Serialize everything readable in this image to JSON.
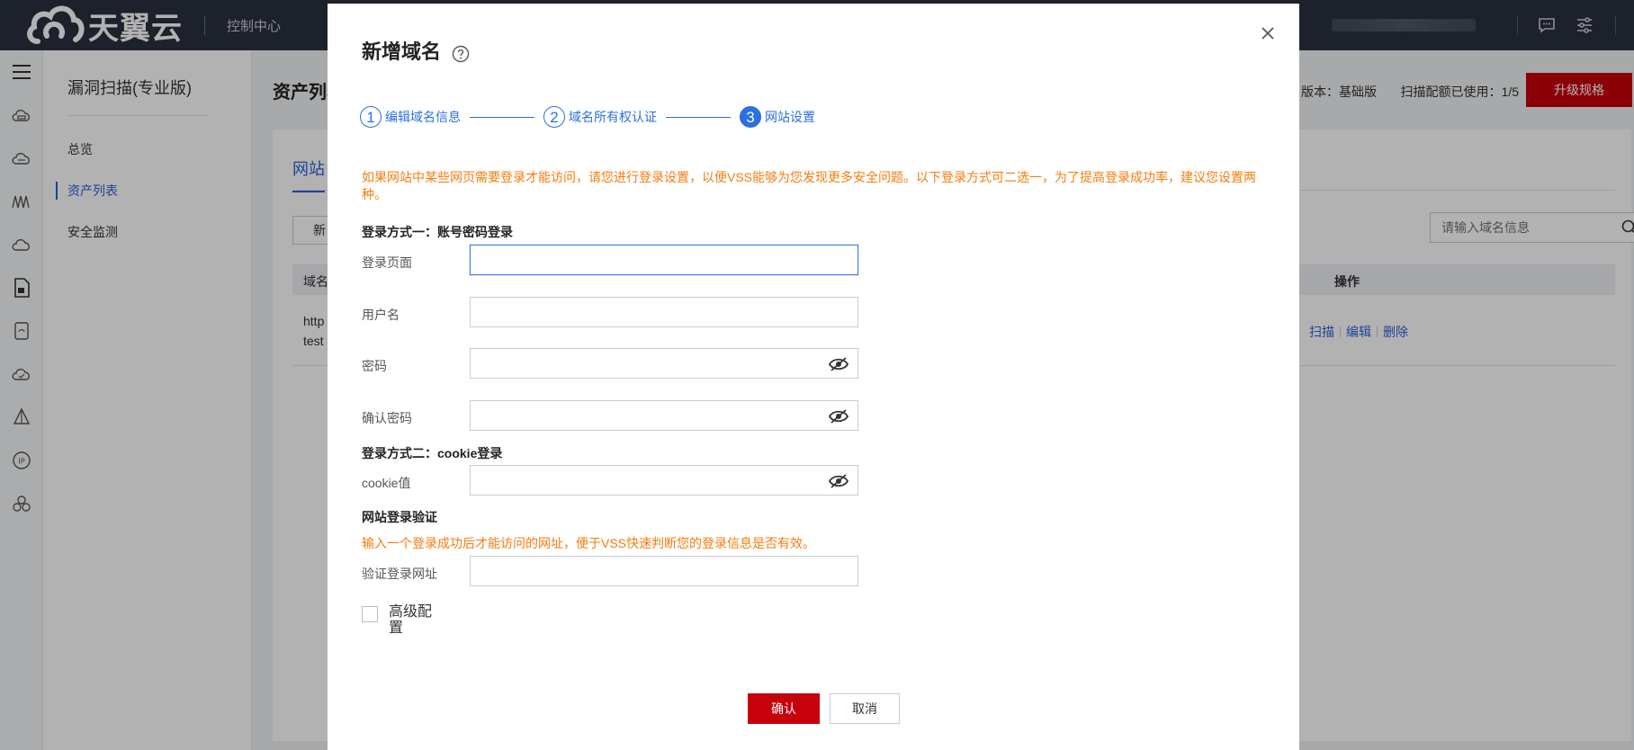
{
  "topbar": {
    "brand": "天翼云",
    "console_link": "控制中心",
    "icons": [
      "message-icon",
      "settings-sliders-icon"
    ]
  },
  "rail": {
    "icons": [
      "menu-icon",
      "cloud-host-icon",
      "cloud-storage-icon",
      "network-icon",
      "cloud-icon",
      "document-icon",
      "device-icon",
      "cloud-check-icon",
      "sail-icon",
      "ip-icon",
      "cluster-icon"
    ]
  },
  "sidebar": {
    "title": "漏洞扫描(专业版)",
    "items": [
      {
        "label": "总览"
      },
      {
        "label": "资产列表"
      },
      {
        "label": "安全监测"
      }
    ]
  },
  "main": {
    "page_title": "资产列表",
    "plan": "版本：基础版",
    "quota": "扫描配额已使用：1/5",
    "upgrade_label": "升级规格",
    "tab_label": "网站",
    "new_button": "新",
    "search_placeholder": "请输入域名信息",
    "table": {
      "col_domain": "域名",
      "col_ops": "操作",
      "row_text_1": "http",
      "row_text_2": "test",
      "ops": [
        "扫描",
        "编辑",
        "删除"
      ]
    }
  },
  "modal": {
    "title": "新增域名",
    "steps": [
      {
        "num": "1",
        "label": "编辑域名信息"
      },
      {
        "num": "2",
        "label": "域名所有权认证"
      },
      {
        "num": "3",
        "label": "网站设置"
      }
    ],
    "notice": "如果网站中某些网页需要登录才能访问，请您进行登录设置，以便VSS能够为您发现更多安全问题。以下登录方式可二选一，为了提高登录成功率，建议您设置两种。",
    "method1_title": "登录方式一：账号密码登录",
    "login_page_label": "登录页面",
    "username_label": "用户名",
    "password_label": "密码",
    "confirm_password_label": "确认密码",
    "method2_title": "登录方式二：cookie登录",
    "cookie_label": "cookie值",
    "verify_title": "网站登录验证",
    "verify_hint": "输入一个登录成功后才能访问的网址，便于VSS快速判断您的登录信息是否有效。",
    "verify_url_label": "验证登录网址",
    "advanced_label": "高级配置",
    "confirm_button": "确认",
    "cancel_button": "取消"
  },
  "colors": {
    "brand_red": "#c7000b",
    "accent_blue": "#2b6fe0",
    "notice_orange": "#f57c0e",
    "topbar_bg": "#2a3040"
  }
}
